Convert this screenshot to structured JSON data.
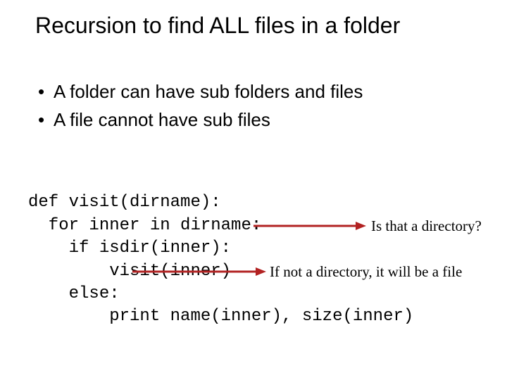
{
  "title": "Recursion to find ALL files in a folder",
  "bullets": [
    "A folder can have sub folders and files",
    "A file cannot have sub files"
  ],
  "code": {
    "l1": "def visit(dirname):",
    "l2": "  for inner in dirname:",
    "l3": "    if isdir(inner):",
    "l4": "        visit(inner)",
    "l5": "    else:",
    "l6": "        print name(inner), size(inner)"
  },
  "annotations": {
    "isDir": "Is that a directory?",
    "elseNote": "If not a directory, it will be a file"
  },
  "colors": {
    "arrow": "#B22222"
  }
}
